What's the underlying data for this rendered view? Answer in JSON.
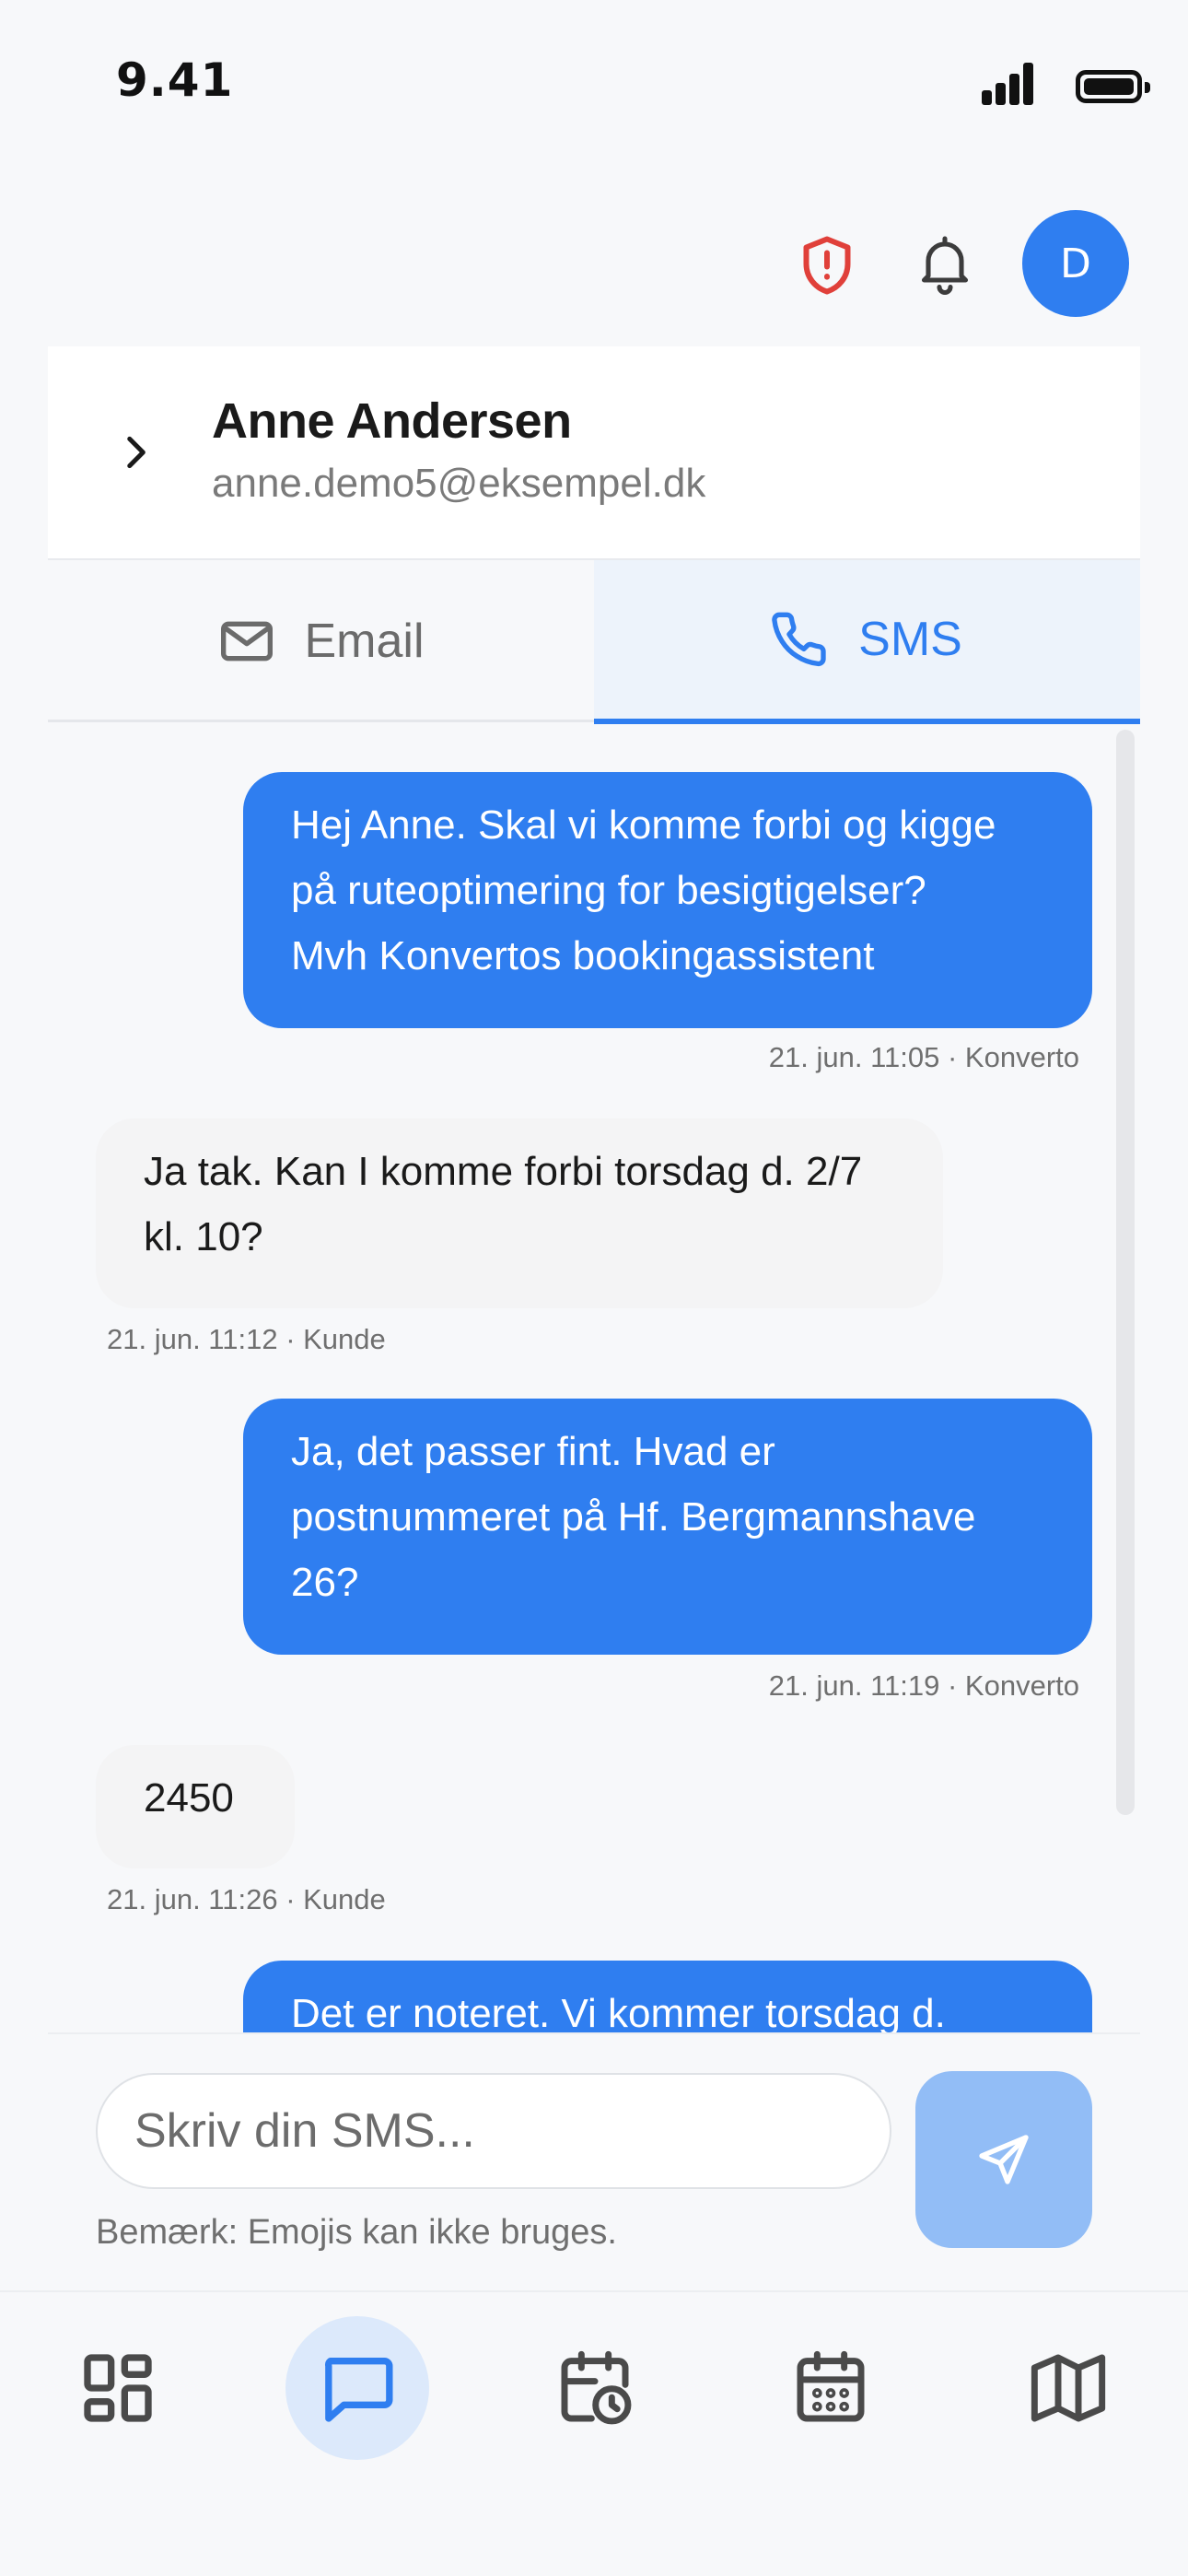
{
  "status_bar": {
    "time": "9.41"
  },
  "header": {
    "avatar_initial": "D"
  },
  "contact": {
    "name": "Anne Andersen",
    "email": "anne.demo5@eksempel.dk"
  },
  "tabs": [
    {
      "label": "Email",
      "active": false
    },
    {
      "label": "SMS",
      "active": true
    }
  ],
  "messages": [
    {
      "direction": "out",
      "lines": [
        "Hej Anne. Skal vi komme forbi og kigge",
        "på ruteoptimering for besigtigelser?",
        "Mvh Konvertos bookingassistent"
      ],
      "meta": "21. jun. 11:05 · Konverto"
    },
    {
      "direction": "in",
      "lines": [
        "Ja tak. Kan I komme forbi torsdag d. 2/7",
        "kl. 10?"
      ],
      "meta": "21. jun. 11:12 · Kunde"
    },
    {
      "direction": "out",
      "lines": [
        "Ja, det passer fint. Hvad er",
        "postnummeret på Hf. Bergmannshave",
        "26?"
      ],
      "meta": "21. jun. 11:19 · Konverto"
    },
    {
      "direction": "in",
      "lines": [
        "2450"
      ],
      "meta": "21. jun. 11:26 · Kunde"
    },
    {
      "direction": "out",
      "lines": [
        "Det er noteret. Vi kommer torsdag d."
      ],
      "meta": ""
    }
  ],
  "composer": {
    "placeholder": "Skriv din SMS...",
    "note": "Bemærk: Emojis kan ikke bruges."
  },
  "nav": [
    {
      "icon": "dashboard-icon",
      "active": false
    },
    {
      "icon": "chat-icon",
      "active": true
    },
    {
      "icon": "calendar-clock-icon",
      "active": false
    },
    {
      "icon": "calendar-icon",
      "active": false
    },
    {
      "icon": "map-icon",
      "active": false
    }
  ],
  "colors": {
    "accent": "#2f7ef0",
    "incoming_bubble": "#f4f4f5",
    "send_button": "#92bdf6",
    "shield": "#e0403a"
  }
}
